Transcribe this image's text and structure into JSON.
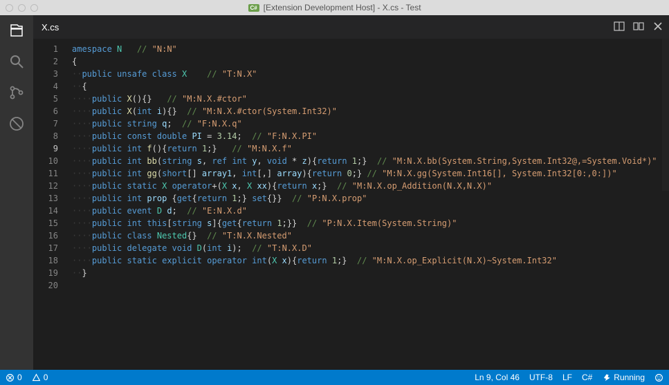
{
  "window": {
    "title": "[Extension Development Host] - X.cs - Test"
  },
  "tabs": {
    "active": "X.cs"
  },
  "status": {
    "errors": "0",
    "warnings": "0",
    "cursor": "Ln 9, Col 46",
    "encoding": "UTF-8",
    "eol": "LF",
    "language": "C#",
    "running": "Running"
  },
  "code": {
    "lines": [
      {
        "num": 1,
        "tokens": [
          {
            "c": "kw",
            "t": "amespace"
          },
          {
            "c": "pun",
            "t": " "
          },
          {
            "c": "typ",
            "t": "N"
          },
          {
            "c": "pun",
            "t": "   "
          },
          {
            "c": "com",
            "t": "// "
          },
          {
            "c": "comq",
            "t": "\"N:N\""
          }
        ]
      },
      {
        "num": 2,
        "tokens": [
          {
            "c": "pun",
            "t": "{"
          }
        ]
      },
      {
        "num": 3,
        "tokens": [
          {
            "c": "ws",
            "t": "··"
          },
          {
            "c": "kw",
            "t": "public"
          },
          {
            "c": "pun",
            "t": " "
          },
          {
            "c": "kw",
            "t": "unsafe"
          },
          {
            "c": "pun",
            "t": " "
          },
          {
            "c": "kw",
            "t": "class"
          },
          {
            "c": "pun",
            "t": " "
          },
          {
            "c": "typ",
            "t": "X"
          },
          {
            "c": "pun",
            "t": "    "
          },
          {
            "c": "com",
            "t": "// "
          },
          {
            "c": "comq",
            "t": "\"T:N.X\""
          }
        ]
      },
      {
        "num": 4,
        "tokens": [
          {
            "c": "ws",
            "t": "··"
          },
          {
            "c": "pun",
            "t": "{"
          }
        ]
      },
      {
        "num": 5,
        "tokens": [
          {
            "c": "ws",
            "t": "····"
          },
          {
            "c": "kw",
            "t": "public"
          },
          {
            "c": "pun",
            "t": " "
          },
          {
            "c": "mem",
            "t": "X"
          },
          {
            "c": "pun",
            "t": "(){}   "
          },
          {
            "c": "com",
            "t": "// "
          },
          {
            "c": "comq",
            "t": "\"M:N.X.#ctor\""
          }
        ]
      },
      {
        "num": 6,
        "tokens": [
          {
            "c": "ws",
            "t": "····"
          },
          {
            "c": "kw",
            "t": "public"
          },
          {
            "c": "pun",
            "t": " "
          },
          {
            "c": "mem",
            "t": "X"
          },
          {
            "c": "pun",
            "t": "("
          },
          {
            "c": "kw",
            "t": "int"
          },
          {
            "c": "pun",
            "t": " "
          },
          {
            "c": "id",
            "t": "i"
          },
          {
            "c": "pun",
            "t": "){}  "
          },
          {
            "c": "com",
            "t": "// "
          },
          {
            "c": "comq",
            "t": "\"M:N.X.#ctor(System.Int32)\""
          }
        ]
      },
      {
        "num": 7,
        "tokens": [
          {
            "c": "ws",
            "t": "····"
          },
          {
            "c": "kw",
            "t": "public"
          },
          {
            "c": "pun",
            "t": " "
          },
          {
            "c": "kw",
            "t": "string"
          },
          {
            "c": "pun",
            "t": " "
          },
          {
            "c": "id",
            "t": "q"
          },
          {
            "c": "pun",
            "t": ";  "
          },
          {
            "c": "com",
            "t": "// "
          },
          {
            "c": "comq",
            "t": "\"F:N.X.q\""
          }
        ]
      },
      {
        "num": 8,
        "tokens": [
          {
            "c": "ws",
            "t": "····"
          },
          {
            "c": "kw",
            "t": "public"
          },
          {
            "c": "pun",
            "t": " "
          },
          {
            "c": "kw",
            "t": "const"
          },
          {
            "c": "pun",
            "t": " "
          },
          {
            "c": "kw",
            "t": "double"
          },
          {
            "c": "pun",
            "t": " "
          },
          {
            "c": "id",
            "t": "PI"
          },
          {
            "c": "pun",
            "t": " = "
          },
          {
            "c": "num",
            "t": "3.14"
          },
          {
            "c": "pun",
            "t": ";  "
          },
          {
            "c": "com",
            "t": "// "
          },
          {
            "c": "comq",
            "t": "\"F:N.X.PI\""
          }
        ]
      },
      {
        "num": 9,
        "tokens": [
          {
            "c": "ws",
            "t": "····"
          },
          {
            "c": "kw",
            "t": "public"
          },
          {
            "c": "pun",
            "t": " "
          },
          {
            "c": "kw",
            "t": "int"
          },
          {
            "c": "pun",
            "t": " "
          },
          {
            "c": "mem",
            "t": "f"
          },
          {
            "c": "pun",
            "t": "(){"
          },
          {
            "c": "kw",
            "t": "return"
          },
          {
            "c": "pun",
            "t": " "
          },
          {
            "c": "num",
            "t": "1"
          },
          {
            "c": "pun",
            "t": ";}   "
          },
          {
            "c": "com",
            "t": "// "
          },
          {
            "c": "comq",
            "t": "\"M:N.X.f\""
          }
        ],
        "current": true
      },
      {
        "num": 10,
        "tokens": [
          {
            "c": "ws",
            "t": "····"
          },
          {
            "c": "kw",
            "t": "public"
          },
          {
            "c": "pun",
            "t": " "
          },
          {
            "c": "kw",
            "t": "int"
          },
          {
            "c": "pun",
            "t": " "
          },
          {
            "c": "mem",
            "t": "bb"
          },
          {
            "c": "pun",
            "t": "("
          },
          {
            "c": "kw",
            "t": "string"
          },
          {
            "c": "pun",
            "t": " "
          },
          {
            "c": "id",
            "t": "s"
          },
          {
            "c": "pun",
            "t": ", "
          },
          {
            "c": "kw",
            "t": "ref"
          },
          {
            "c": "pun",
            "t": " "
          },
          {
            "c": "kw",
            "t": "int"
          },
          {
            "c": "pun",
            "t": " "
          },
          {
            "c": "id",
            "t": "y"
          },
          {
            "c": "pun",
            "t": ", "
          },
          {
            "c": "kw",
            "t": "void"
          },
          {
            "c": "pun",
            "t": " * "
          },
          {
            "c": "id",
            "t": "z"
          },
          {
            "c": "pun",
            "t": "){"
          },
          {
            "c": "kw",
            "t": "return"
          },
          {
            "c": "pun",
            "t": " "
          },
          {
            "c": "num",
            "t": "1"
          },
          {
            "c": "pun",
            "t": ";}  "
          },
          {
            "c": "com",
            "t": "// "
          },
          {
            "c": "comq",
            "t": "\"M:N.X.bb(System.String,System.Int32@,=System.Void*)\""
          }
        ]
      },
      {
        "num": 11,
        "tokens": [
          {
            "c": "ws",
            "t": "····"
          },
          {
            "c": "kw",
            "t": "public"
          },
          {
            "c": "pun",
            "t": " "
          },
          {
            "c": "kw",
            "t": "int"
          },
          {
            "c": "pun",
            "t": " "
          },
          {
            "c": "mem",
            "t": "gg"
          },
          {
            "c": "pun",
            "t": "("
          },
          {
            "c": "kw",
            "t": "short"
          },
          {
            "c": "pun",
            "t": "[] "
          },
          {
            "c": "id",
            "t": "array1"
          },
          {
            "c": "pun",
            "t": ", "
          },
          {
            "c": "kw",
            "t": "int"
          },
          {
            "c": "pun",
            "t": "[,] "
          },
          {
            "c": "id",
            "t": "array"
          },
          {
            "c": "pun",
            "t": "){"
          },
          {
            "c": "kw",
            "t": "return"
          },
          {
            "c": "pun",
            "t": " "
          },
          {
            "c": "num",
            "t": "0"
          },
          {
            "c": "pun",
            "t": ";} "
          },
          {
            "c": "com",
            "t": "// "
          },
          {
            "c": "comq",
            "t": "\"M:N.X.gg(System.Int16[], System.Int32[0:,0:])\""
          }
        ]
      },
      {
        "num": 12,
        "tokens": [
          {
            "c": "ws",
            "t": "····"
          },
          {
            "c": "kw",
            "t": "public"
          },
          {
            "c": "pun",
            "t": " "
          },
          {
            "c": "kw",
            "t": "static"
          },
          {
            "c": "pun",
            "t": " "
          },
          {
            "c": "typ",
            "t": "X"
          },
          {
            "c": "pun",
            "t": " "
          },
          {
            "c": "kw",
            "t": "operator"
          },
          {
            "c": "pun",
            "t": "+("
          },
          {
            "c": "typ",
            "t": "X"
          },
          {
            "c": "pun",
            "t": " "
          },
          {
            "c": "id",
            "t": "x"
          },
          {
            "c": "pun",
            "t": ", "
          },
          {
            "c": "typ",
            "t": "X"
          },
          {
            "c": "pun",
            "t": " "
          },
          {
            "c": "id",
            "t": "xx"
          },
          {
            "c": "pun",
            "t": "){"
          },
          {
            "c": "kw",
            "t": "return"
          },
          {
            "c": "pun",
            "t": " "
          },
          {
            "c": "id",
            "t": "x"
          },
          {
            "c": "pun",
            "t": ";}  "
          },
          {
            "c": "com",
            "t": "// "
          },
          {
            "c": "comq",
            "t": "\"M:N.X.op_Addition(N.X,N.X)\""
          }
        ]
      },
      {
        "num": 13,
        "tokens": [
          {
            "c": "ws",
            "t": "····"
          },
          {
            "c": "kw",
            "t": "public"
          },
          {
            "c": "pun",
            "t": " "
          },
          {
            "c": "kw",
            "t": "int"
          },
          {
            "c": "pun",
            "t": " "
          },
          {
            "c": "id",
            "t": "prop"
          },
          {
            "c": "pun",
            "t": " {"
          },
          {
            "c": "kw",
            "t": "get"
          },
          {
            "c": "pun",
            "t": "{"
          },
          {
            "c": "kw",
            "t": "return"
          },
          {
            "c": "pun",
            "t": " "
          },
          {
            "c": "num",
            "t": "1"
          },
          {
            "c": "pun",
            "t": ";} "
          },
          {
            "c": "kw",
            "t": "set"
          },
          {
            "c": "pun",
            "t": "{}}  "
          },
          {
            "c": "com",
            "t": "// "
          },
          {
            "c": "comq",
            "t": "\"P:N.X.prop\""
          }
        ]
      },
      {
        "num": 14,
        "tokens": [
          {
            "c": "ws",
            "t": "····"
          },
          {
            "c": "kw",
            "t": "public"
          },
          {
            "c": "pun",
            "t": " "
          },
          {
            "c": "kw",
            "t": "event"
          },
          {
            "c": "pun",
            "t": " "
          },
          {
            "c": "typ",
            "t": "D"
          },
          {
            "c": "pun",
            "t": " "
          },
          {
            "c": "id",
            "t": "d"
          },
          {
            "c": "pun",
            "t": ";  "
          },
          {
            "c": "com",
            "t": "// "
          },
          {
            "c": "comq",
            "t": "\"E:N.X.d\""
          }
        ]
      },
      {
        "num": 15,
        "tokens": [
          {
            "c": "ws",
            "t": "····"
          },
          {
            "c": "kw",
            "t": "public"
          },
          {
            "c": "pun",
            "t": " "
          },
          {
            "c": "kw",
            "t": "int"
          },
          {
            "c": "pun",
            "t": " "
          },
          {
            "c": "kw",
            "t": "this"
          },
          {
            "c": "pun",
            "t": "["
          },
          {
            "c": "kw",
            "t": "string"
          },
          {
            "c": "pun",
            "t": " "
          },
          {
            "c": "id",
            "t": "s"
          },
          {
            "c": "pun",
            "t": "]{"
          },
          {
            "c": "kw",
            "t": "get"
          },
          {
            "c": "pun",
            "t": "{"
          },
          {
            "c": "kw",
            "t": "return"
          },
          {
            "c": "pun",
            "t": " "
          },
          {
            "c": "num",
            "t": "1"
          },
          {
            "c": "pun",
            "t": ";}}  "
          },
          {
            "c": "com",
            "t": "// "
          },
          {
            "c": "comq",
            "t": "\"P:N.X.Item(System.String)\""
          }
        ]
      },
      {
        "num": 16,
        "tokens": [
          {
            "c": "ws",
            "t": "····"
          },
          {
            "c": "kw",
            "t": "public"
          },
          {
            "c": "pun",
            "t": " "
          },
          {
            "c": "kw",
            "t": "class"
          },
          {
            "c": "pun",
            "t": " "
          },
          {
            "c": "typ",
            "t": "Nested"
          },
          {
            "c": "pun",
            "t": "{}  "
          },
          {
            "c": "com",
            "t": "// "
          },
          {
            "c": "comq",
            "t": "\"T:N.X.Nested\""
          }
        ]
      },
      {
        "num": 17,
        "tokens": [
          {
            "c": "ws",
            "t": "····"
          },
          {
            "c": "kw",
            "t": "public"
          },
          {
            "c": "pun",
            "t": " "
          },
          {
            "c": "kw",
            "t": "delegate"
          },
          {
            "c": "pun",
            "t": " "
          },
          {
            "c": "kw",
            "t": "void"
          },
          {
            "c": "pun",
            "t": " "
          },
          {
            "c": "typ",
            "t": "D"
          },
          {
            "c": "pun",
            "t": "("
          },
          {
            "c": "kw",
            "t": "int"
          },
          {
            "c": "pun",
            "t": " "
          },
          {
            "c": "id",
            "t": "i"
          },
          {
            "c": "pun",
            "t": ");  "
          },
          {
            "c": "com",
            "t": "// "
          },
          {
            "c": "comq",
            "t": "\"T:N.X.D\""
          }
        ]
      },
      {
        "num": 18,
        "tokens": [
          {
            "c": "ws",
            "t": "····"
          },
          {
            "c": "kw",
            "t": "public"
          },
          {
            "c": "pun",
            "t": " "
          },
          {
            "c": "kw",
            "t": "static"
          },
          {
            "c": "pun",
            "t": " "
          },
          {
            "c": "kw",
            "t": "explicit"
          },
          {
            "c": "pun",
            "t": " "
          },
          {
            "c": "kw",
            "t": "operator"
          },
          {
            "c": "pun",
            "t": " "
          },
          {
            "c": "kw",
            "t": "int"
          },
          {
            "c": "pun",
            "t": "("
          },
          {
            "c": "typ",
            "t": "X"
          },
          {
            "c": "pun",
            "t": " "
          },
          {
            "c": "id",
            "t": "x"
          },
          {
            "c": "pun",
            "t": "){"
          },
          {
            "c": "kw",
            "t": "return"
          },
          {
            "c": "pun",
            "t": " "
          },
          {
            "c": "num",
            "t": "1"
          },
          {
            "c": "pun",
            "t": ";}  "
          },
          {
            "c": "com",
            "t": "// "
          },
          {
            "c": "comq",
            "t": "\"M:N.X.op_Explicit(N.X)~System.Int32\""
          }
        ]
      },
      {
        "num": 19,
        "tokens": [
          {
            "c": "ws",
            "t": "··"
          },
          {
            "c": "pun",
            "t": "}"
          }
        ]
      },
      {
        "num": 20,
        "tokens": []
      }
    ]
  }
}
